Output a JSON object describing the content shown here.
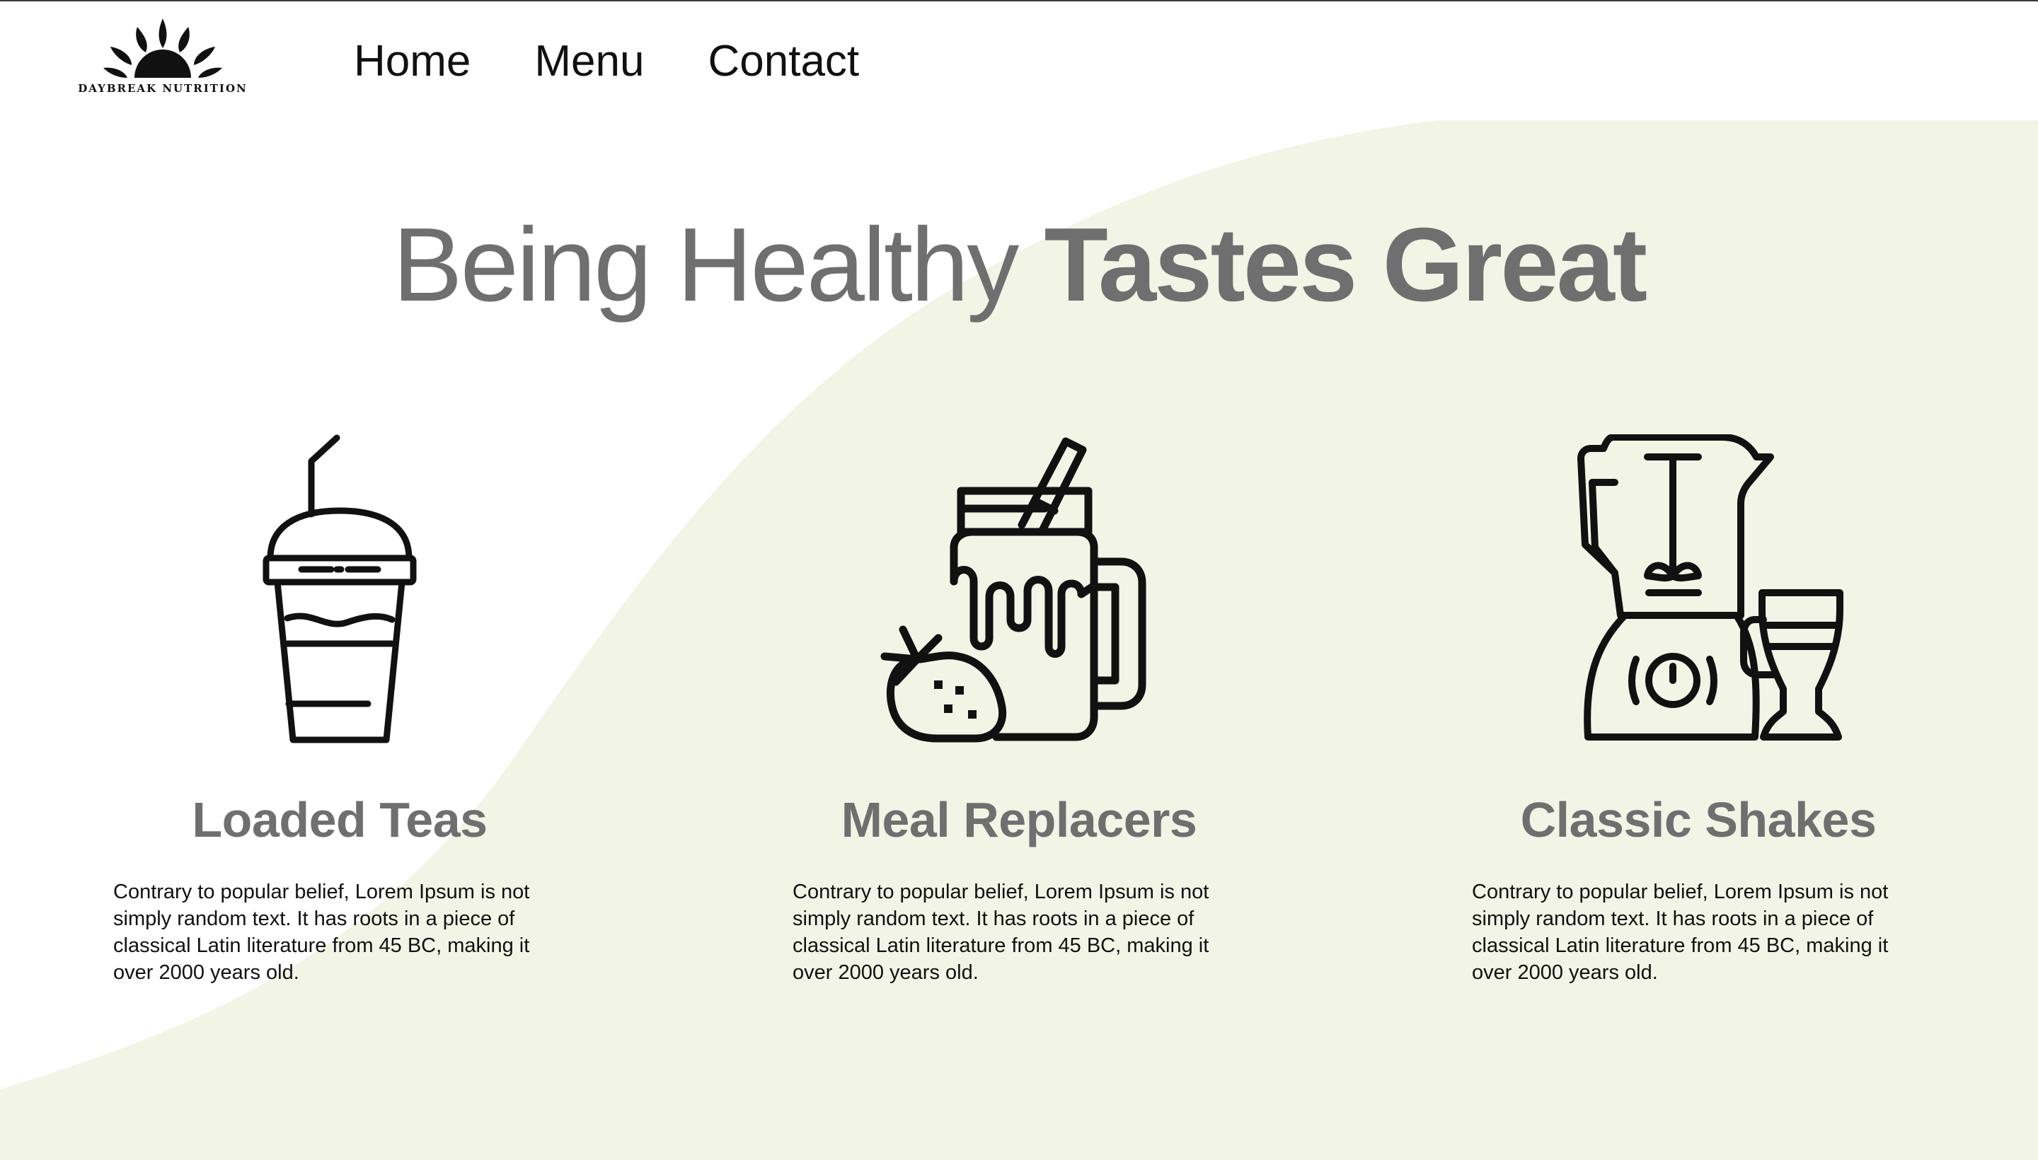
{
  "brand": {
    "name": "DAYBREAK NUTRITION",
    "logo_icon": "sunrise-leaves-icon"
  },
  "nav": {
    "items": [
      {
        "label": "Home"
      },
      {
        "label": "Menu"
      },
      {
        "label": "Contact"
      }
    ]
  },
  "hero": {
    "title_light": "Being Healthy",
    "title_bold": "Tastes Great"
  },
  "features": [
    {
      "icon": "bubble-tea-cup-icon",
      "title": "Loaded Teas",
      "body": "Contrary to popular belief, Lorem Ipsum is not simply random text. It has roots in a piece of classical Latin literature from 45 BC, making it over 2000 years old."
    },
    {
      "icon": "smoothie-jar-strawberry-icon",
      "title": "Meal Replacers",
      "body": "Contrary to popular belief, Lorem Ipsum is not simply random text. It has roots in a piece of classical Latin literature from 45 BC, making it over 2000 years old."
    },
    {
      "icon": "blender-glass-icon",
      "title": "Classic Shakes",
      "body": "Contrary to popular belief, Lorem Ipsum is not simply random text. It has roots in a piece of classical Latin literature from 45 BC, making it over 2000 years old."
    }
  ],
  "colors": {
    "background": "#ffffff",
    "wave": "#f2f4e6",
    "heading": "#6f6f6f",
    "text": "#111111"
  }
}
